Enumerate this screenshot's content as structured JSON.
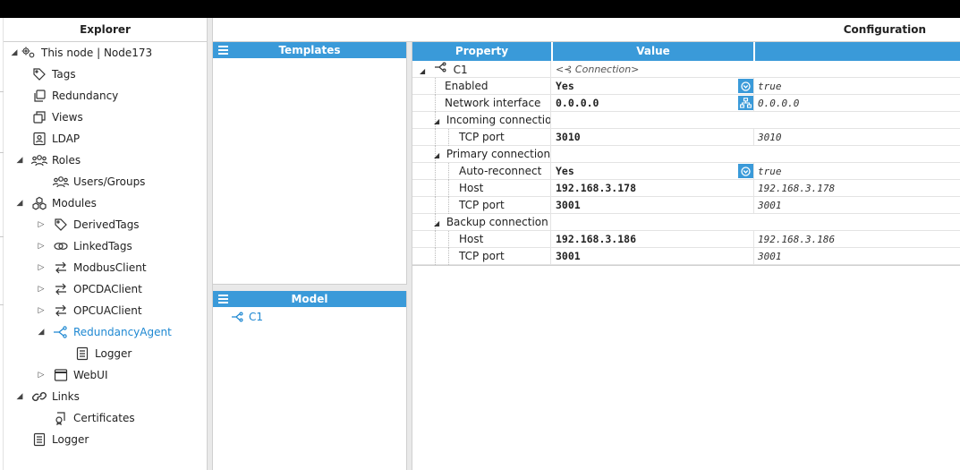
{
  "explorer": {
    "title": "Explorer",
    "items": [
      {
        "label": "This node | Node173",
        "icon": "node-gear-icon",
        "expander": "◢"
      },
      {
        "label": "Tags",
        "icon": "tag-icon"
      },
      {
        "label": "Redundancy",
        "icon": "redundancy-icon"
      },
      {
        "label": "Views",
        "icon": "views-icon"
      },
      {
        "label": "LDAP",
        "icon": "ldap-icon"
      },
      {
        "label": "Roles",
        "icon": "roles-icon",
        "expander": "◢"
      },
      {
        "label": "Users/Groups",
        "icon": "users-groups-icon"
      },
      {
        "label": "Modules",
        "icon": "modules-icon",
        "expander": "◢"
      },
      {
        "label": "DerivedTags",
        "icon": "tag-icon",
        "expander": "▷"
      },
      {
        "label": "LinkedTags",
        "icon": "linked-tags-icon",
        "expander": "▷"
      },
      {
        "label": "ModbusClient",
        "icon": "arrows-exchange-icon",
        "expander": "▷"
      },
      {
        "label": "OPCDAClient",
        "icon": "arrows-exchange-icon",
        "expander": "▷"
      },
      {
        "label": "OPCUAClient",
        "icon": "arrows-exchange-icon",
        "expander": "▷"
      },
      {
        "label": "RedundancyAgent",
        "icon": "redundancy-agent-icon",
        "expander": "◢"
      },
      {
        "label": "Logger",
        "icon": "logger-icon"
      },
      {
        "label": "WebUI",
        "icon": "webui-window-icon",
        "expander": "▷"
      },
      {
        "label": "Links",
        "icon": "link-icon",
        "expander": "◢"
      },
      {
        "label": "Certificates",
        "icon": "certificate-icon"
      },
      {
        "label": "Logger",
        "icon": "logger-icon"
      }
    ]
  },
  "configuration": {
    "title": "Configuration"
  },
  "templates": {
    "title": "Templates"
  },
  "model": {
    "title": "Model",
    "items": [
      {
        "label": "C1",
        "icon": "connection-icon"
      }
    ]
  },
  "grid": {
    "headers": {
      "property": "Property",
      "value": "Value"
    },
    "rows": [
      {
        "property": "C1",
        "value": "<⊰ Connection>",
        "default": "",
        "group": true
      },
      {
        "property": "Enabled",
        "value": "Yes",
        "default": "true",
        "control": "dropdown"
      },
      {
        "property": "Network interface",
        "value": "0.0.0.0",
        "default": "0.0.0.0",
        "control": "network"
      },
      {
        "property": "Incoming connection",
        "value": "",
        "default": "",
        "group": true
      },
      {
        "property": "TCP port",
        "value": "3010",
        "default": "3010"
      },
      {
        "property": "Primary connection",
        "value": "",
        "default": "",
        "group": true
      },
      {
        "property": "Auto-reconnect",
        "value": "Yes",
        "default": "true",
        "control": "dropdown"
      },
      {
        "property": "Host",
        "value": "192.168.3.178",
        "default": "192.168.3.178"
      },
      {
        "property": "TCP port",
        "value": "3001",
        "default": "3001"
      },
      {
        "property": "Backup connection",
        "value": "",
        "default": "",
        "group": true
      },
      {
        "property": "Host",
        "value": "192.168.3.186",
        "default": "192.168.3.186"
      },
      {
        "property": "TCP port",
        "value": "3001",
        "default": "3001"
      }
    ]
  },
  "colors": {
    "accent": "#3a9ad9",
    "selected": "#1e88d2"
  }
}
